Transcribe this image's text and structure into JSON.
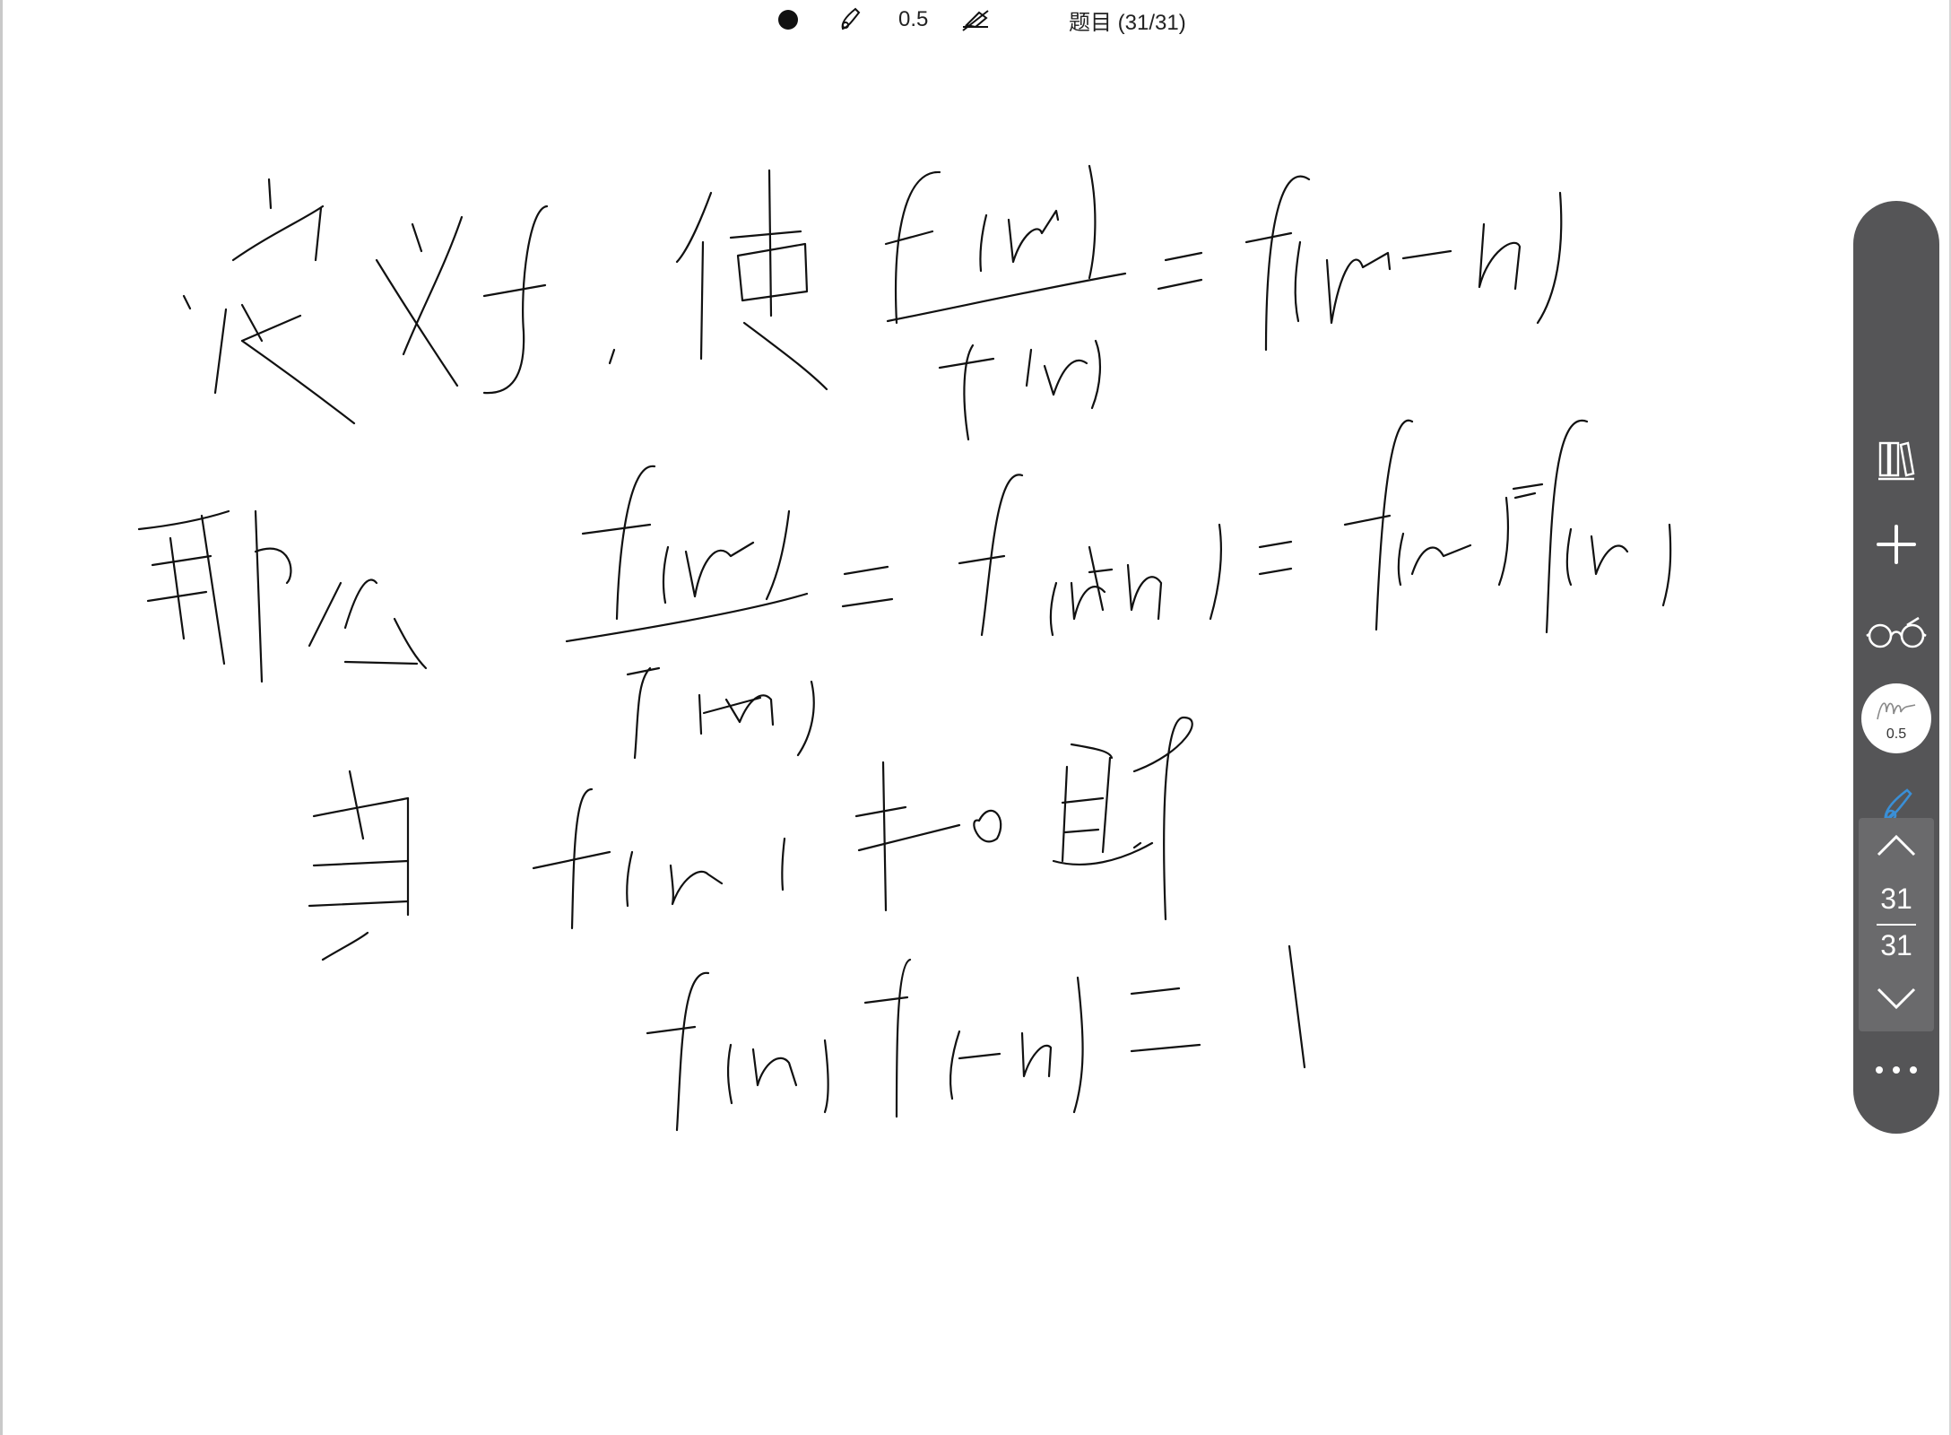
{
  "status_bar": {
    "pen_size": "0.5",
    "title": "题目 (31/31)"
  },
  "toolbar": {
    "pen_preview_size": "0.5",
    "current_page": "31",
    "total_pages": "31",
    "icons": [
      "library-icon",
      "add-icon",
      "glasses-icon",
      "pen-preview-icon",
      "pen-tool-icon",
      "eraser-tool-icon",
      "undo-icon",
      "page-up-icon",
      "page-down-icon",
      "more-icon"
    ]
  },
  "colors": {
    "toolbar_bg": "#555557",
    "page_box_bg": "#6a6a6c",
    "active_tool": "#3a8fd6",
    "ink": "#111111"
  }
}
